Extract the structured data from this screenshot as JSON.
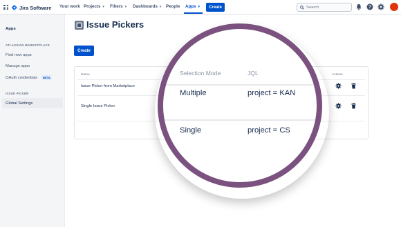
{
  "topnav": {
    "product_name": "Jira Software",
    "items": [
      {
        "label": "Your work",
        "has_chevron": false
      },
      {
        "label": "Projects",
        "has_chevron": true
      },
      {
        "label": "Filters",
        "has_chevron": true
      },
      {
        "label": "Dashboards",
        "has_chevron": true
      },
      {
        "label": "People",
        "has_chevron": false
      },
      {
        "label": "Apps",
        "has_chevron": true,
        "active": true
      }
    ],
    "create_label": "Create",
    "search_placeholder": "Search",
    "icons": [
      "notification-icon",
      "help-icon",
      "settings-icon",
      "avatar"
    ]
  },
  "sidebar": {
    "heading": "Apps",
    "section_marketplace": "ATLASSIAN MARKETPLACE",
    "items": [
      {
        "label": "Find new apps"
      },
      {
        "label": "Manage apps"
      },
      {
        "label": "OAuth credentials",
        "badge": "BETA"
      }
    ],
    "section_issue_picker": "ISSUE PICKER",
    "active_item": "Global Settings"
  },
  "main": {
    "title": "Issue Pickers",
    "create_label": "Create",
    "table": {
      "headers": {
        "name": "Name",
        "actions": "Actions"
      },
      "rows": [
        {
          "name": "Issue Picker from Marketplace"
        },
        {
          "name": "Single Issue Picker"
        }
      ]
    }
  },
  "magnifier": {
    "headers": {
      "mode": "Selection Mode",
      "jql": "JQL"
    },
    "rows": [
      {
        "mode": "Multiple",
        "jql": "project = KAN"
      },
      {
        "mode": "Single",
        "jql": "project = CS"
      }
    ]
  },
  "colors": {
    "brand_blue": "#0052cc",
    "magnifier_ring": "#7b517f",
    "avatar": "#de350b"
  }
}
